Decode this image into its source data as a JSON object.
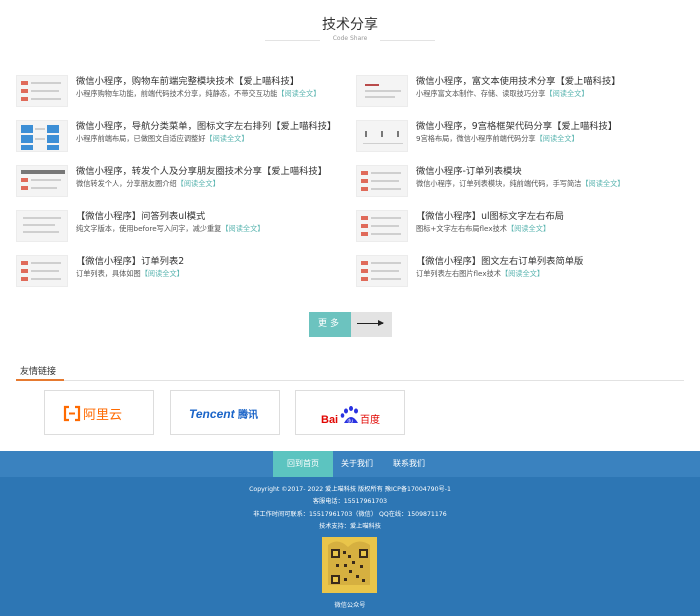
{
  "header": {
    "title": "技术分享",
    "subtitle": "Code Share"
  },
  "articles": [
    {
      "title": "微信小程序，购物车前端完整模块技术【爱上喵科技】",
      "desc": "小程序购物车功能，前端代码技术分享，纯静态，不带交互功能",
      "more": "【阅读全文】"
    },
    {
      "title": "微信小程序，富文本使用技术分享【爱上喵科技】",
      "desc": "小程序富文本制作、存储、读取技巧分享",
      "more": "【阅读全文】"
    },
    {
      "title": "微信小程序，导航分类菜单，图标文字左右排列【爱上喵科技】",
      "desc": "小程序前端布局，已做图文自适应调整好",
      "more": "【阅读全文】"
    },
    {
      "title": "微信小程序，9宫格框架代码分享【爱上喵科技】",
      "desc": "9宫格布局，微信小程序前端代码分享",
      "more": "【阅读全文】"
    },
    {
      "title": "微信小程序，转发个人及分享朋友圈技术分享【爱上喵科技】",
      "desc": "微信转发个人，分享朋友圈介绍",
      "more": "【阅读全文】"
    },
    {
      "title": "微信小程序-订单列表模块",
      "desc": "微信小程序，订单列表模块，纯前端代码，手写简洁",
      "more": "【阅读全文】"
    },
    {
      "title": "【微信小程序】问答列表ul模式",
      "desc": "纯文字版本，使用before写入问字，减少重复",
      "more": "【阅读全文】"
    },
    {
      "title": "【微信小程序】ul图标文字左右布局",
      "desc": "图标+文字左右布局flex技术",
      "more": "【阅读全文】"
    },
    {
      "title": "【微信小程序】订单列表2",
      "desc": "订单列表，具体如图",
      "more": "【阅读全文】"
    },
    {
      "title": "【微信小程序】图文左右订单列表简单版",
      "desc": "订单列表左右图片flex技术",
      "more": "【阅读全文】"
    }
  ],
  "more_button": {
    "label": "更多"
  },
  "links": {
    "title": "友情链接",
    "partners": [
      {
        "name": "阿里云",
        "color": "#ff6a00"
      },
      {
        "name": "Tencent腾讯",
        "color": "#1a64c8"
      },
      {
        "name": "Bai百度",
        "color": "#e10602"
      }
    ],
    "baidu_bai": "Bai",
    "baidu_du": "du",
    "baidu_cn": "百度",
    "tencent_en": "Tencent",
    "tencent_cn": "腾讯"
  },
  "footer": {
    "nav": [
      "回到首页",
      "关于我们",
      "联系我们"
    ],
    "copyright": "Copyright ©2017- 2022 爱上喵科技 版权所有 豫ICP备17004790号-1",
    "phone": "客服电话：15517961703",
    "offhours": "非工作时间可联系：15517961703（微信） QQ在线：1509871176",
    "support": "技术支持：爱上喵科技",
    "qr_caption": "微信公众号"
  },
  "colors": {
    "accent_teal": "#6cc3bf",
    "footer_blue": "#2d76b4",
    "links_accent": "#e67a30"
  }
}
